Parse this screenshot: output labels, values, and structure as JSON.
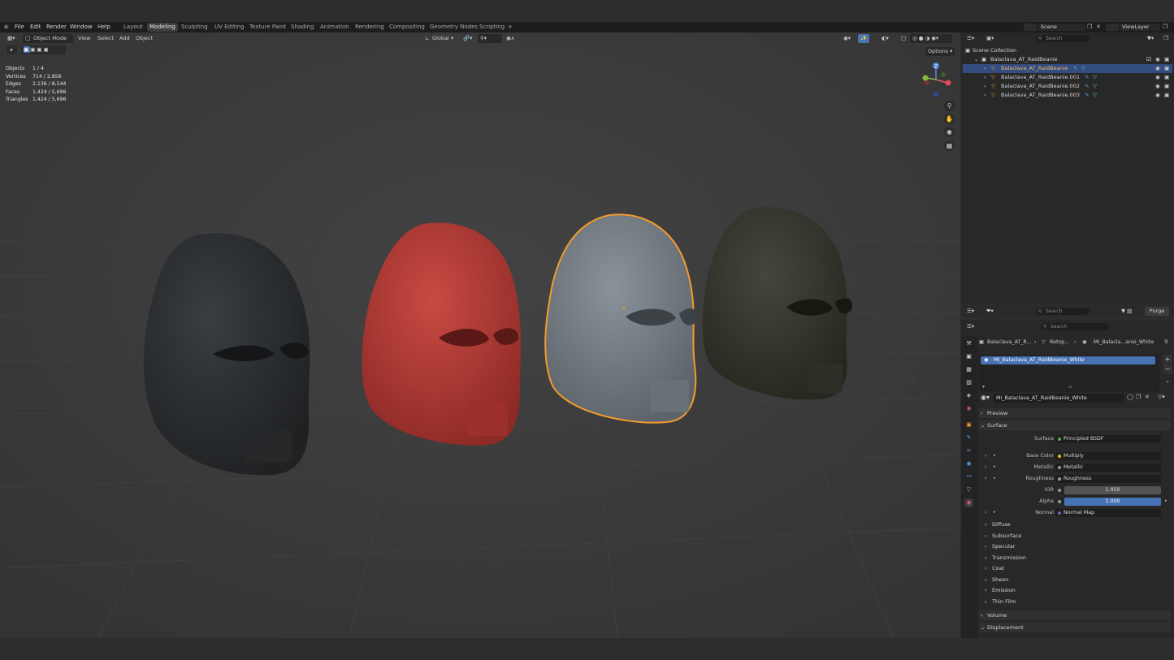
{
  "menubar": {
    "items": [
      "File",
      "Edit",
      "Render",
      "Window",
      "Help"
    ],
    "workspaces": [
      "Layout",
      "Modeling",
      "Sculpting",
      "UV Editing",
      "Texture Paint",
      "Shading",
      "Animation",
      "Rendering",
      "Compositing",
      "Geometry Nodes",
      "Scripting"
    ],
    "active_workspace": "Modeling",
    "add_tab": "+",
    "scene_label": "Scene",
    "viewlayer_label": "ViewLayer"
  },
  "viewport": {
    "mode": "Object Mode",
    "menus": [
      "View",
      "Select",
      "Add",
      "Object"
    ],
    "orientation": "Global",
    "options_label": "Options",
    "stats": [
      {
        "label": "Objects",
        "value": "1 / 4"
      },
      {
        "label": "Vertices",
        "value": "714 / 2,856"
      },
      {
        "label": "Edges",
        "value": "2,136 / 8,544"
      },
      {
        "label": "Faces",
        "value": "1,424 / 5,696"
      },
      {
        "label": "Triangles",
        "value": "1,424 / 5,696"
      }
    ],
    "gizmo_z": "Z",
    "masks": [
      {
        "color": "#2e3134",
        "name": "black"
      },
      {
        "color": "#b8403a",
        "name": "red"
      },
      {
        "color": "#7d858d",
        "name": "grey"
      },
      {
        "color": "#3a3a31",
        "name": "olive"
      }
    ],
    "selection_color": "#f39b2c"
  },
  "outliner": {
    "search_placeholder": "Search",
    "root": "Scene Collection",
    "collection": "Balaclava_AT_RaidBeanie",
    "objects": [
      {
        "name": "Balaclava_AT_RaidBeanie",
        "selected": true
      },
      {
        "name": "Balaclava_AT_RaidBeanie.001",
        "selected": false
      },
      {
        "name": "Balaclava_AT_RaidBeanie.002",
        "selected": false
      },
      {
        "name": "Balaclava_AT_RaidBeanie.003",
        "selected": false
      }
    ]
  },
  "fileview": {
    "search_placeholder": "Search",
    "purge_label": "Purge"
  },
  "properties": {
    "search_placeholder": "Search",
    "breadcrumb": [
      "Balaclava_AT_R...",
      "Retop...",
      "MI_Balacla...anie_White"
    ],
    "material_slot": "MI_Balaclava_AT_RaidBeanie_White",
    "material_name": "MI_Balaclava_AT_RaidBeanie_White",
    "sections": {
      "preview": "Preview",
      "surface": "Surface"
    },
    "surface_rows": [
      {
        "label": "Surface",
        "value": "Principled BSDF",
        "dot": "#4caf50"
      },
      {
        "label": "Base Color",
        "value": "Multiply",
        "dot": "#e2c400"
      },
      {
        "label": "Metallic",
        "value": "Metallic",
        "dot": "#9a9a9a"
      },
      {
        "label": "Roughness",
        "value": "Roughness",
        "dot": "#9a9a9a"
      },
      {
        "label": "IOR",
        "value": "1.450",
        "dot": "#9a9a9a"
      },
      {
        "label": "Alpha",
        "value": "1.000",
        "dot": "#9a9a9a"
      },
      {
        "label": "Normal",
        "value": "Normal Map",
        "dot": "#6464c8"
      }
    ],
    "subsections": [
      "Diffuse",
      "Subsurface",
      "Specular",
      "Transmission",
      "Coat",
      "Sheen",
      "Emission",
      "Thin Film"
    ],
    "volume": "Volume",
    "displacement": "Displacement",
    "accent": "#4772b3"
  }
}
